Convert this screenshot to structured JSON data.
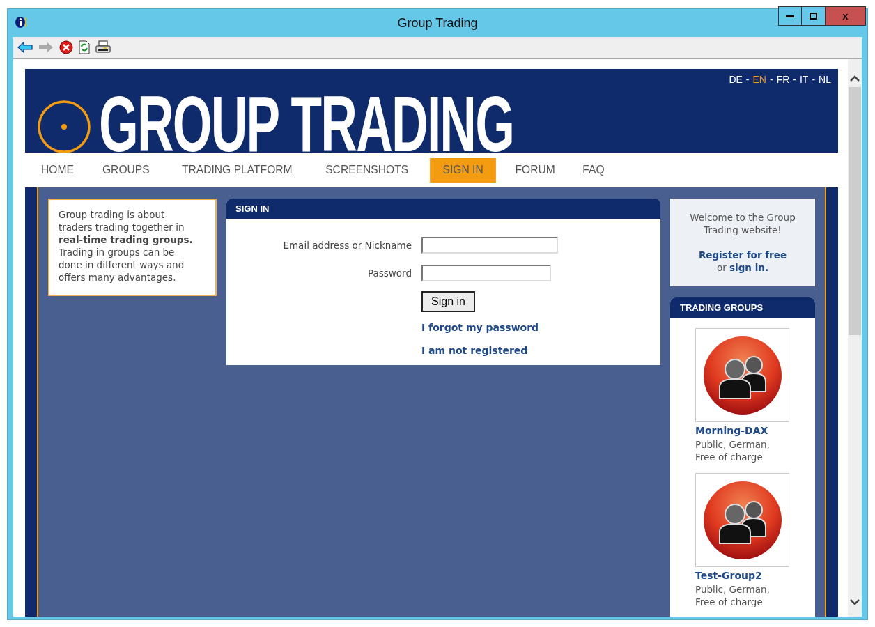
{
  "window": {
    "title": "Group Trading",
    "close_label": "x"
  },
  "language_separator": "-",
  "languages": [
    {
      "label": "DE",
      "selected": false
    },
    {
      "label": "EN",
      "selected": true
    },
    {
      "label": "FR",
      "selected": false
    },
    {
      "label": "IT",
      "selected": false
    },
    {
      "label": "NL",
      "selected": false
    }
  ],
  "logo": {
    "text": "GROUP TRADING"
  },
  "nav": [
    {
      "label": "HOME",
      "selected": false
    },
    {
      "label": "GROUPS",
      "selected": false
    },
    {
      "label": "TRADING PLATFORM",
      "selected": false
    },
    {
      "label": "SCREENSHOTS",
      "selected": false
    },
    {
      "label": "SIGN IN",
      "selected": true
    },
    {
      "label": "FORUM",
      "selected": false
    },
    {
      "label": "FAQ",
      "selected": false
    }
  ],
  "intro": "Group trading is about traders trading together in **real-time trading groups.** Trading in groups can be done in different ways and offers many advantages.",
  "sign_in": {
    "title": "SIGN IN",
    "fields": [
      {
        "label": "Email address or Nickname"
      },
      {
        "label": "Password"
      }
    ],
    "button": "Sign in",
    "links": [
      "I forgot my password",
      "I am not registered"
    ]
  },
  "welcome": {
    "text": "Welcome to the Group Trading website!",
    "register_link": "Register for free",
    "or": "or",
    "sign_in_link": "sign in."
  },
  "trading_groups": {
    "title": "TRADING GROUPS",
    "groups": [
      {
        "name": "Morning-DAX",
        "description": "Public, German, Free of charge"
      },
      {
        "name": "Test-Group2",
        "description": "Public, German, Free of charge"
      }
    ]
  }
}
